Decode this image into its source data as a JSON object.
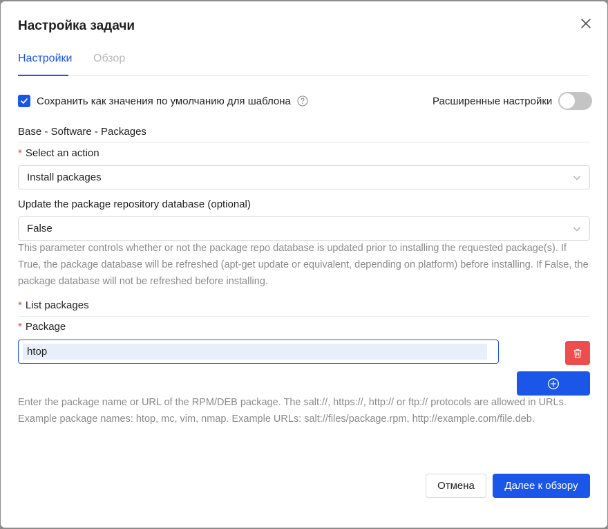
{
  "dialog": {
    "title": "Настройка задачи",
    "tabs": [
      {
        "label": "Настройки",
        "active": true
      },
      {
        "label": "Обзор",
        "active": false
      }
    ]
  },
  "options": {
    "save_default_label": "Сохранить как значения по умолчанию для шаблона",
    "save_default_checked": true,
    "advanced_label": "Расширенные настройки",
    "advanced_enabled": false
  },
  "section": {
    "title": "Base - Software - Packages"
  },
  "action": {
    "label": "Select an action",
    "required": true,
    "value": "Install packages"
  },
  "update_repo": {
    "label": "Update the package repository database (optional)",
    "value": "False",
    "help": "This parameter controls whether or not the package repo database is updated prior to installing the requested package(s). If True, the package database will be refreshed (apt-get update or equivalent, depending on platform) before installing. If False, the package database will not be refreshed before installing."
  },
  "packages": {
    "list_label": "List packages",
    "package_label": "Package",
    "items": [
      "htop"
    ],
    "help": "Enter the package name or URL of the RPM/DEB package. The salt://, https://, http:// or ftp:// protocols are allowed in URLs. Example package names: htop, mc, vim, nmap. Example URLs: salt://files/package.rpm, http://example.com/file.deb."
  },
  "footer": {
    "cancel_label": "Отмена",
    "next_label": "Далее к обзору"
  },
  "colors": {
    "accent": "#1a56e8",
    "danger": "#ee4d4d",
    "required": "#e8433b"
  }
}
